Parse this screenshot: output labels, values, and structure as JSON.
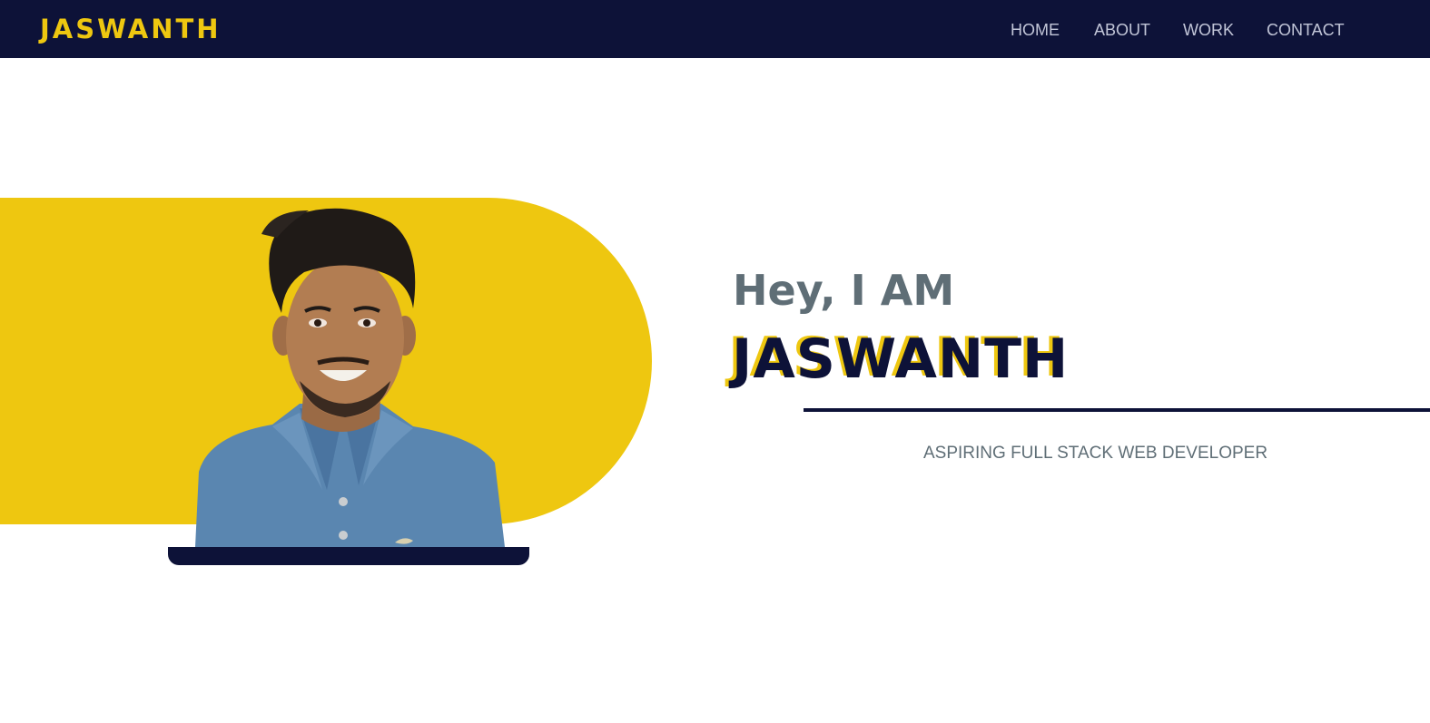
{
  "nav": {
    "logo": "JASWANTH",
    "links": [
      "HOME",
      "ABOUT",
      "WORK",
      "CONTACT"
    ]
  },
  "hero": {
    "greeting": "Hey, I AM",
    "name": "JASWANTH",
    "tagline": "ASPIRING FULL STACK WEB DEVELOPER",
    "portrait_icon": "person-portrait"
  },
  "colors": {
    "navy": "#0d1238",
    "yellow": "#eec710",
    "gray": "#5f6e76",
    "nav_text": "#c2c6d8"
  }
}
